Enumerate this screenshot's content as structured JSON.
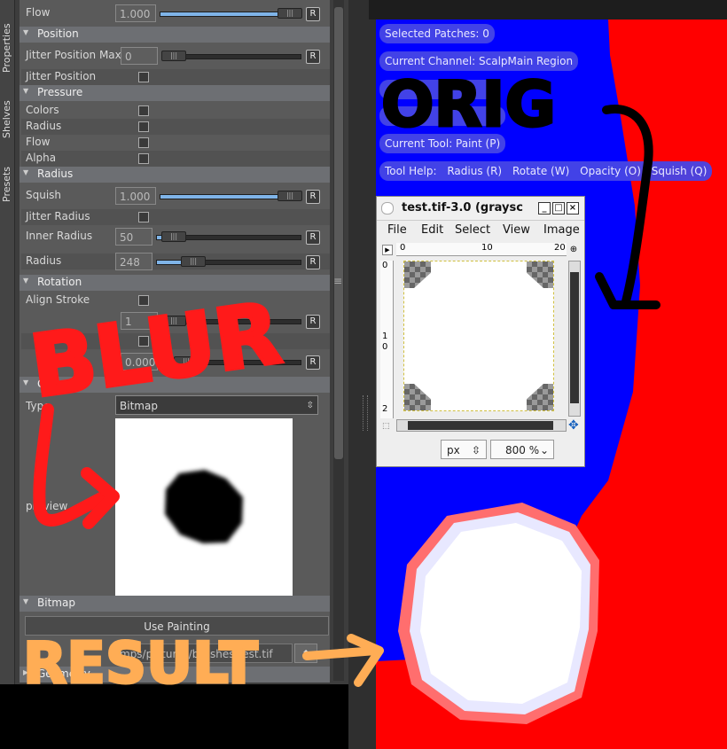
{
  "side_tabs": [
    "Properties",
    "Shelves",
    "Presets"
  ],
  "brush": {
    "flow_label": "Flow",
    "flow_value": "1.000",
    "reset_label": "R",
    "sections": {
      "position": "Position",
      "pressure": "Pressure",
      "radius": "Radius",
      "rotation": "Rotation",
      "general": "General",
      "bitmap": "Bitmap"
    },
    "jitter_position_max_label": "Jitter Position Max",
    "jitter_position_max_value": "0",
    "jitter_position_label": "Jitter Position",
    "pressure_colors": "Colors",
    "pressure_radius": "Radius",
    "pressure_flow": "Flow",
    "pressure_alpha": "Alpha",
    "squish_label": "Squish",
    "squish_value": "1.000",
    "jitter_radius_label": "Jitter Radius",
    "inner_radius_label": "Inner Radius",
    "inner_radius_value": "50",
    "radius_label": "Radius",
    "radius_value": "248",
    "align_stroke_label": "Align Stroke",
    "jitter_rotation_max_value": "1",
    "rotation_value": "0.000",
    "type_label": "Type",
    "type_value": "Bitmap",
    "preview_label": "preview",
    "use_painting_label": "Use Painting",
    "file_path": "mps/pictures/brushes/test.tif",
    "next_section": "Geometry"
  },
  "viewport": {
    "selected_patches": "Selected Patches: 0",
    "current_channel": "Current Channel: ScalpMain Region",
    "current_tool": "Current Tool: Paint (P)",
    "tool_help_label": "Tool Help:",
    "tool_help_items": [
      "Radius (R)",
      "Rotate (W)",
      "Opacity (O)",
      "Squish (Q)"
    ]
  },
  "image_window": {
    "title": "test.tif-3.0 (graysc",
    "menu": [
      "File",
      "Edit",
      "Select",
      "View",
      "Image"
    ],
    "ruler_h": [
      "0",
      "10",
      "20"
    ],
    "ruler_v": [
      "0",
      "1",
      "0",
      "2"
    ],
    "unit": "px",
    "zoom": "800 %"
  },
  "annotations": {
    "blur": "BLUR",
    "orig": "ORIG",
    "result": "RESULT",
    "colors": {
      "red": "#ff1111",
      "black": "#000000",
      "orange": "#ffaa44"
    }
  },
  "colors": {
    "viewport_blue": "#0000ff",
    "viewport_red": "#ff0000",
    "panel_bg": "#5a5a5a",
    "slider_fill": "#7fb4e8"
  }
}
